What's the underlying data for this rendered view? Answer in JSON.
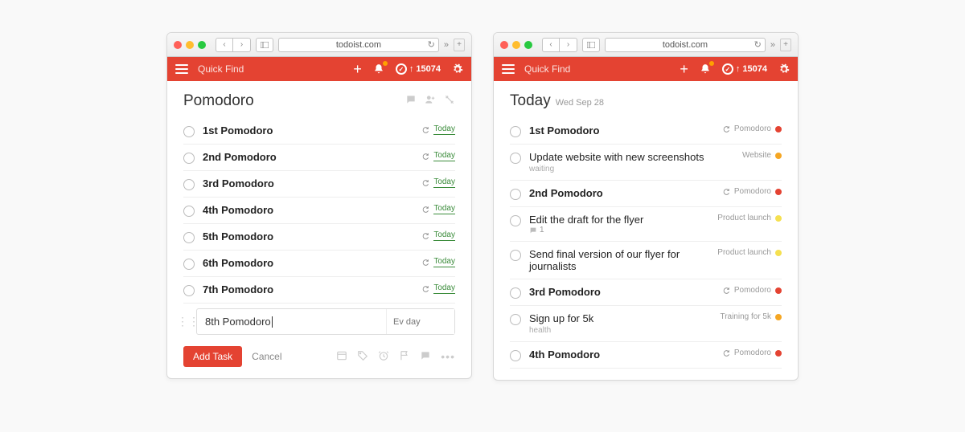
{
  "browser": {
    "url": "todoist.com"
  },
  "header": {
    "quickfind_placeholder": "Quick Find",
    "karma": "15074"
  },
  "left": {
    "title": "Pomodoro",
    "tasks": [
      {
        "title": "1st Pomodoro",
        "date": "Today"
      },
      {
        "title": "2nd Pomodoro",
        "date": "Today"
      },
      {
        "title": "3rd Pomodoro",
        "date": "Today"
      },
      {
        "title": "4th Pomodoro",
        "date": "Today"
      },
      {
        "title": "5th Pomodoro",
        "date": "Today"
      },
      {
        "title": "6th Pomodoro",
        "date": "Today"
      },
      {
        "title": "7th Pomodoro",
        "date": "Today"
      }
    ],
    "new_task_value": "8th Pomodoro",
    "schedule_placeholder": "Ev day",
    "add_button": "Add Task",
    "cancel_link": "Cancel"
  },
  "right": {
    "title": "Today",
    "date": "Wed Sep 28",
    "tasks": [
      {
        "title": "1st Pomodoro",
        "bold": true,
        "recur": true,
        "project": "Pomodoro",
        "color": "#e44332"
      },
      {
        "title": "Update website with new screenshots",
        "sub": "waiting",
        "project": "Website",
        "color": "#f5a623"
      },
      {
        "title": "2nd Pomodoro",
        "bold": true,
        "recur": true,
        "project": "Pomodoro",
        "color": "#e44332"
      },
      {
        "title": "Edit the draft for the flyer",
        "comments": "1",
        "project": "Product launch",
        "color": "#f5e050"
      },
      {
        "title": "Send final version of our flyer for journalists",
        "project": "Product launch",
        "color": "#f5e050"
      },
      {
        "title": "3rd Pomodoro",
        "bold": true,
        "recur": true,
        "project": "Pomodoro",
        "color": "#e44332"
      },
      {
        "title": "Sign up for 5k",
        "sub": "health",
        "project": "Training for 5k",
        "color": "#f5a623"
      },
      {
        "title": "4th Pomodoro",
        "bold": true,
        "recur": true,
        "project": "Pomodoro",
        "color": "#e44332"
      }
    ]
  }
}
